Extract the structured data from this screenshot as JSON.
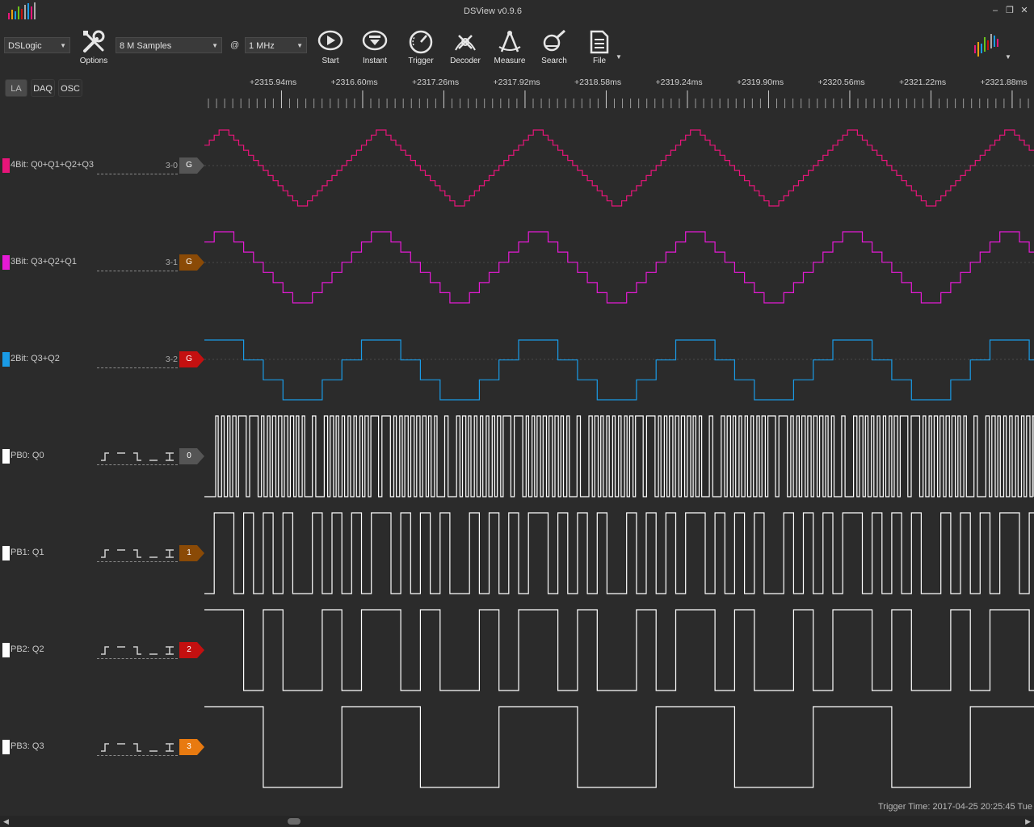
{
  "window": {
    "title": "DSView v0.9.6",
    "logo": "dsview-logo-icon",
    "controls": {
      "minimize": "–",
      "restore": "❐",
      "close": "✕"
    }
  },
  "toolbar": {
    "device": "DSLogic",
    "samples": "8 M Samples",
    "at": "@",
    "rate": "1 MHz",
    "tools": [
      {
        "label": "Options",
        "icon": "tools-icon"
      },
      {
        "label": "Start",
        "icon": "play-icon"
      },
      {
        "label": "Instant",
        "icon": "instant-icon"
      },
      {
        "label": "Trigger",
        "icon": "trigger-gauge-icon"
      },
      {
        "label": "Decoder",
        "icon": "decoder-icon"
      },
      {
        "label": "Measure",
        "icon": "measure-icon"
      },
      {
        "label": "Search",
        "icon": "search-icon"
      },
      {
        "label": "File",
        "icon": "file-icon"
      }
    ]
  },
  "modes": [
    "LA",
    "DAQ",
    "OSC"
  ],
  "active_mode": "LA",
  "ruler": {
    "labels": [
      "+2315.94ms",
      "+2316.60ms",
      "+2317.26ms",
      "+2317.92ms",
      "+2318.58ms",
      "+2319.24ms",
      "+2319.90ms",
      "+2320.56ms",
      "+2321.22ms",
      "+2321.88ms"
    ]
  },
  "channels": [
    {
      "name": "4Bit: Q0+Q1+Q2+Q3",
      "range": "3-0",
      "tag": "G",
      "color": "#e8157a",
      "tag_color": "#555555",
      "kind": "group"
    },
    {
      "name": "3Bit: Q3+Q2+Q1",
      "range": "3-1",
      "tag": "G",
      "color": "#e61ad6",
      "tag_color": "#8a4a06",
      "kind": "group"
    },
    {
      "name": "2Bit: Q3+Q2",
      "range": "3-2",
      "tag": "G",
      "color": "#1a9be6",
      "tag_color": "#c41010",
      "kind": "group"
    },
    {
      "name": "PB0: Q0",
      "tag": "0",
      "color": "#ffffff",
      "tag_color": "#555555",
      "kind": "logic"
    },
    {
      "name": "PB1: Q1",
      "tag": "1",
      "color": "#ffffff",
      "tag_color": "#8a4a06",
      "kind": "logic"
    },
    {
      "name": "PB2: Q2",
      "tag": "2",
      "color": "#ffffff",
      "tag_color": "#c41010",
      "kind": "logic"
    },
    {
      "name": "PB3: Q3",
      "tag": "3",
      "color": "#ffffff",
      "tag_color": "#e87a10",
      "kind": "logic"
    }
  ],
  "status": {
    "trigger_time": "Trigger Time: 2017-04-25 20:25:45 Tue"
  }
}
